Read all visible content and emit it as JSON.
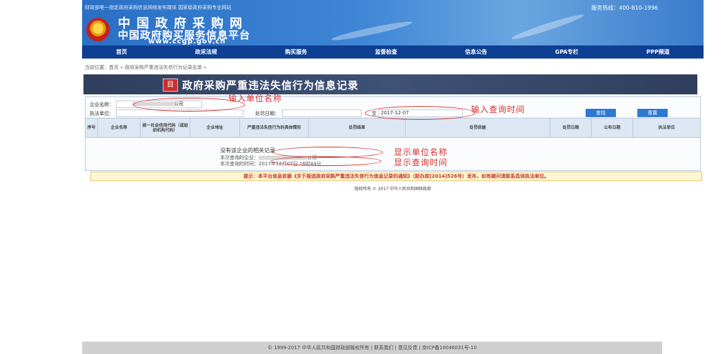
{
  "header": {
    "top_link": "财政部唯一指定政府采购信息网络发布媒体 国家级政府采购专业网站",
    "hotline": "服务热线：400-810-1996",
    "title": "中国政府采购网",
    "subtitle": "中国政府购买服务信息平台",
    "url": "www.ccgp.gov.cn"
  },
  "nav": [
    "首页",
    "政采法规",
    "购买服务",
    "监督检查",
    "信息公告",
    "GPA专栏",
    "PPP频道"
  ],
  "breadcrumb": "当前位置：首页 » 政府采购严重违法失信行为记录名单 »",
  "banner": {
    "icon": "目",
    "title": "政府采购严重违法失信行为信息记录"
  },
  "form": {
    "company_label": "企业名称：",
    "company_value": "公司",
    "agency_label": "执法单位：",
    "date_label": "处罚日期：",
    "date_to_label": "至",
    "date_value": "2017-12-07",
    "search_button": "查找",
    "reset_button": "重置"
  },
  "table": {
    "columns": [
      "序号",
      "企业名称",
      "统一社会信用代码（或组织机构代码）",
      "企业地址",
      "严重违法失信行为的具体情形",
      "处罚结果",
      "处罚依据",
      "处罚日期",
      "公布日期",
      "执法单位"
    ]
  },
  "result": {
    "none_found": "没有该企业的相关记录",
    "queried_company_prefix": "本次查询的企业：",
    "queried_company_suffix": "公司",
    "queried_time_prefix": "本次查询的时间：",
    "queried_time": "2017年12月07日 16时44分"
  },
  "annotations": {
    "input_company": "输入单位名称",
    "input_time": "输入查询时间",
    "show_company": "显示单位名称",
    "show_time": "显示查询时间"
  },
  "notice": "提示：本平台信息依据《关于报送政府采购严重违法失信行为信息记录的通知》（财办库[2014]526号）发布，如有疑问请联系具体执法单位。",
  "copyright": "版权所有 © 2017 中华人民共和国财政部",
  "footer": "© 1999-2017 中华人民共和国财政部版权所有 | 联系我们 | 意见反馈 | 京ICP备10046031号-10",
  "colors": {
    "nav_bg": "#0d3f93",
    "annotation_red": "#d9302c",
    "button_blue": "#2d78d4"
  }
}
